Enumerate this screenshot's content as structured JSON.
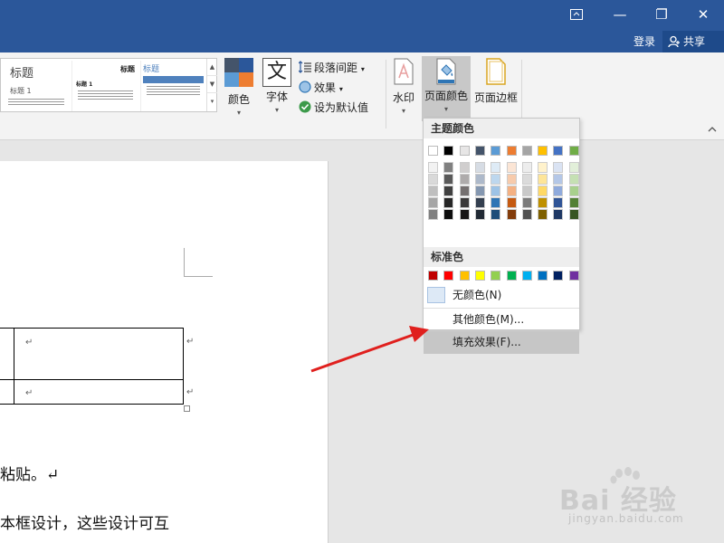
{
  "window": {
    "restore_ribbon_icon": "ribbon-display-icon",
    "minimize_glyph": "—",
    "maximize_glyph": "❐",
    "close_glyph": "✕"
  },
  "account": {
    "signin_label": "登录",
    "share_label": "共享"
  },
  "ribbon": {
    "styles": {
      "thumb1_title": "标题",
      "thumb1_sub": "标题 1",
      "thumb2_title": "标题",
      "thumb2_head": "标题 1",
      "thumb3_title": "标题",
      "scroll_up": "▲",
      "scroll_down": "▼",
      "scroll_more": "▾"
    },
    "colors_label": "颜色",
    "fonts_label": "字体",
    "fonts_glyph": "文",
    "paragraph_spacing_label": "段落间距",
    "effects_label": "效果",
    "set_default_label": "设为默认值",
    "watermark_label": "水印",
    "page_color_label": "页面颜色",
    "page_border_label": "页面边框",
    "caret": "▾"
  },
  "dropdown": {
    "theme_colors_header": "主题颜色",
    "standard_colors_header": "标准色",
    "no_color_label": "无颜色(N)",
    "more_colors_label": "其他颜色(M)...",
    "fill_effects_label": "填充效果(F)...",
    "theme_top_row": [
      "#ffffff",
      "#000000",
      "#e7e6e6",
      "#44546a",
      "#5b9bd5",
      "#ed7d31",
      "#a5a5a5",
      "#ffc000",
      "#4472c4",
      "#70ad47"
    ],
    "theme_shades": [
      [
        "#f2f2f2",
        "#d9d9d9",
        "#bfbfbf",
        "#a6a6a6",
        "#808080"
      ],
      [
        "#808080",
        "#595959",
        "#404040",
        "#262626",
        "#0d0d0d"
      ],
      [
        "#d0cece",
        "#aeabab",
        "#757070",
        "#3a3838",
        "#171616"
      ],
      [
        "#d6dce4",
        "#adb9ca",
        "#8497b0",
        "#333f4f",
        "#222a35"
      ],
      [
        "#deebf6",
        "#bdd7ee",
        "#9dc3e6",
        "#2e75b5",
        "#1f4e79"
      ],
      [
        "#fbe5d5",
        "#f7cbac",
        "#f4b183",
        "#c55a11",
        "#833c0b"
      ],
      [
        "#ededed",
        "#dbdbdb",
        "#c9c9c9",
        "#7b7b7b",
        "#525252"
      ],
      [
        "#fff2cc",
        "#fee599",
        "#ffd966",
        "#bf9000",
        "#7f6000"
      ],
      [
        "#dae3f3",
        "#b4c7e7",
        "#8faadc",
        "#2f5496",
        "#1f3864"
      ],
      [
        "#e2efd9",
        "#c5e0b3",
        "#a8d08d",
        "#538135",
        "#375623"
      ]
    ],
    "standard_colors": [
      "#c00000",
      "#ff0000",
      "#ffc000",
      "#ffff00",
      "#92d050",
      "#00b050",
      "#00b0f0",
      "#0070c0",
      "#002060",
      "#7030a0"
    ]
  },
  "document": {
    "paragraph_mark": "↵",
    "line1": "粘贴。↵",
    "line2": "本框设计，这些设计可互"
  },
  "watermark_logo": {
    "text": "Bai 经验",
    "url": "jingyan.baidu.com"
  },
  "colors": {
    "titlebar": "#2b579a",
    "arrow": "#e0201e",
    "selected_button": "#c8c8c8"
  }
}
